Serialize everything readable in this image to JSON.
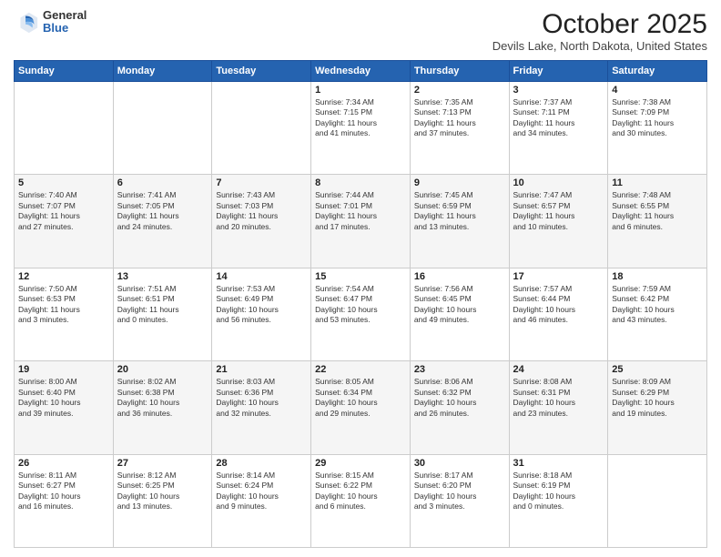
{
  "header": {
    "logo": {
      "general": "General",
      "blue": "Blue"
    },
    "title": "October 2025",
    "location": "Devils Lake, North Dakota, United States"
  },
  "weekdays": [
    "Sunday",
    "Monday",
    "Tuesday",
    "Wednesday",
    "Thursday",
    "Friday",
    "Saturday"
  ],
  "weeks": [
    [
      {
        "day": "",
        "info": ""
      },
      {
        "day": "",
        "info": ""
      },
      {
        "day": "",
        "info": ""
      },
      {
        "day": "1",
        "info": "Sunrise: 7:34 AM\nSunset: 7:15 PM\nDaylight: 11 hours\nand 41 minutes."
      },
      {
        "day": "2",
        "info": "Sunrise: 7:35 AM\nSunset: 7:13 PM\nDaylight: 11 hours\nand 37 minutes."
      },
      {
        "day": "3",
        "info": "Sunrise: 7:37 AM\nSunset: 7:11 PM\nDaylight: 11 hours\nand 34 minutes."
      },
      {
        "day": "4",
        "info": "Sunrise: 7:38 AM\nSunset: 7:09 PM\nDaylight: 11 hours\nand 30 minutes."
      }
    ],
    [
      {
        "day": "5",
        "info": "Sunrise: 7:40 AM\nSunset: 7:07 PM\nDaylight: 11 hours\nand 27 minutes."
      },
      {
        "day": "6",
        "info": "Sunrise: 7:41 AM\nSunset: 7:05 PM\nDaylight: 11 hours\nand 24 minutes."
      },
      {
        "day": "7",
        "info": "Sunrise: 7:43 AM\nSunset: 7:03 PM\nDaylight: 11 hours\nand 20 minutes."
      },
      {
        "day": "8",
        "info": "Sunrise: 7:44 AM\nSunset: 7:01 PM\nDaylight: 11 hours\nand 17 minutes."
      },
      {
        "day": "9",
        "info": "Sunrise: 7:45 AM\nSunset: 6:59 PM\nDaylight: 11 hours\nand 13 minutes."
      },
      {
        "day": "10",
        "info": "Sunrise: 7:47 AM\nSunset: 6:57 PM\nDaylight: 11 hours\nand 10 minutes."
      },
      {
        "day": "11",
        "info": "Sunrise: 7:48 AM\nSunset: 6:55 PM\nDaylight: 11 hours\nand 6 minutes."
      }
    ],
    [
      {
        "day": "12",
        "info": "Sunrise: 7:50 AM\nSunset: 6:53 PM\nDaylight: 11 hours\nand 3 minutes."
      },
      {
        "day": "13",
        "info": "Sunrise: 7:51 AM\nSunset: 6:51 PM\nDaylight: 11 hours\nand 0 minutes."
      },
      {
        "day": "14",
        "info": "Sunrise: 7:53 AM\nSunset: 6:49 PM\nDaylight: 10 hours\nand 56 minutes."
      },
      {
        "day": "15",
        "info": "Sunrise: 7:54 AM\nSunset: 6:47 PM\nDaylight: 10 hours\nand 53 minutes."
      },
      {
        "day": "16",
        "info": "Sunrise: 7:56 AM\nSunset: 6:45 PM\nDaylight: 10 hours\nand 49 minutes."
      },
      {
        "day": "17",
        "info": "Sunrise: 7:57 AM\nSunset: 6:44 PM\nDaylight: 10 hours\nand 46 minutes."
      },
      {
        "day": "18",
        "info": "Sunrise: 7:59 AM\nSunset: 6:42 PM\nDaylight: 10 hours\nand 43 minutes."
      }
    ],
    [
      {
        "day": "19",
        "info": "Sunrise: 8:00 AM\nSunset: 6:40 PM\nDaylight: 10 hours\nand 39 minutes."
      },
      {
        "day": "20",
        "info": "Sunrise: 8:02 AM\nSunset: 6:38 PM\nDaylight: 10 hours\nand 36 minutes."
      },
      {
        "day": "21",
        "info": "Sunrise: 8:03 AM\nSunset: 6:36 PM\nDaylight: 10 hours\nand 32 minutes."
      },
      {
        "day": "22",
        "info": "Sunrise: 8:05 AM\nSunset: 6:34 PM\nDaylight: 10 hours\nand 29 minutes."
      },
      {
        "day": "23",
        "info": "Sunrise: 8:06 AM\nSunset: 6:32 PM\nDaylight: 10 hours\nand 26 minutes."
      },
      {
        "day": "24",
        "info": "Sunrise: 8:08 AM\nSunset: 6:31 PM\nDaylight: 10 hours\nand 23 minutes."
      },
      {
        "day": "25",
        "info": "Sunrise: 8:09 AM\nSunset: 6:29 PM\nDaylight: 10 hours\nand 19 minutes."
      }
    ],
    [
      {
        "day": "26",
        "info": "Sunrise: 8:11 AM\nSunset: 6:27 PM\nDaylight: 10 hours\nand 16 minutes."
      },
      {
        "day": "27",
        "info": "Sunrise: 8:12 AM\nSunset: 6:25 PM\nDaylight: 10 hours\nand 13 minutes."
      },
      {
        "day": "28",
        "info": "Sunrise: 8:14 AM\nSunset: 6:24 PM\nDaylight: 10 hours\nand 9 minutes."
      },
      {
        "day": "29",
        "info": "Sunrise: 8:15 AM\nSunset: 6:22 PM\nDaylight: 10 hours\nand 6 minutes."
      },
      {
        "day": "30",
        "info": "Sunrise: 8:17 AM\nSunset: 6:20 PM\nDaylight: 10 hours\nand 3 minutes."
      },
      {
        "day": "31",
        "info": "Sunrise: 8:18 AM\nSunset: 6:19 PM\nDaylight: 10 hours\nand 0 minutes."
      },
      {
        "day": "",
        "info": ""
      }
    ]
  ]
}
